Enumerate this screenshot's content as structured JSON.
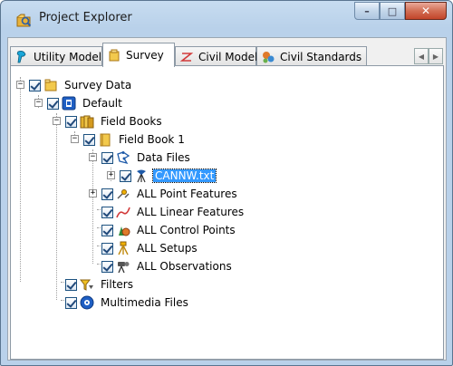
{
  "window": {
    "title": "Project Explorer"
  },
  "caption_buttons": {
    "minimize": "–",
    "maximize": "□",
    "close": "✕"
  },
  "tabs": [
    {
      "label": "Utility Model",
      "icon": "utility-model-icon",
      "active": false
    },
    {
      "label": "Survey",
      "icon": "survey-folder-icon",
      "active": true
    },
    {
      "label": "Civil Model",
      "icon": "civil-model-icon",
      "active": false
    },
    {
      "label": "Civil Standards",
      "icon": "civil-standards-icon",
      "active": false
    }
  ],
  "tab_scroll": {
    "left": "◀",
    "right": "▶"
  },
  "tree": [
    {
      "label": "Survey Data",
      "icon": "folder-icon",
      "expander": "−",
      "checked": true,
      "level": 0
    },
    {
      "label": "Default",
      "icon": "survey-project-icon",
      "expander": "−",
      "checked": true,
      "level": 1
    },
    {
      "label": "Field Books",
      "icon": "field-books-icon",
      "expander": "−",
      "checked": true,
      "level": 2
    },
    {
      "label": "Field Book 1",
      "icon": "folder-icon",
      "expander": "−",
      "checked": true,
      "level": 3
    },
    {
      "label": "Data Files",
      "icon": "data-files-icon",
      "expander": "−",
      "checked": true,
      "level": 4
    },
    {
      "label": "CANNW.txt",
      "icon": "data-file-icon",
      "expander": "+",
      "checked": true,
      "level": 5,
      "selected": true
    },
    {
      "label": "ALL Point Features",
      "icon": "point-features-icon",
      "expander": "+",
      "checked": true,
      "level": 4
    },
    {
      "label": "ALL Linear Features",
      "icon": "linear-features-icon",
      "expander": "",
      "checked": true,
      "level": 4
    },
    {
      "label": "ALL Control Points",
      "icon": "control-points-icon",
      "expander": "",
      "checked": true,
      "level": 4
    },
    {
      "label": "ALL Setups",
      "icon": "setups-icon",
      "expander": "",
      "checked": true,
      "level": 4
    },
    {
      "label": "ALL Observations",
      "icon": "observations-icon",
      "expander": "",
      "checked": true,
      "level": 4
    },
    {
      "label": "Filters",
      "icon": "filters-icon",
      "expander": "",
      "checked": true,
      "level": 2
    },
    {
      "label": "Multimedia Files",
      "icon": "multimedia-icon",
      "expander": "",
      "checked": true,
      "level": 2
    }
  ],
  "colors": {
    "selection": "#3399ff",
    "title_bar": "#b9d1ea",
    "close_button": "#c2452a"
  }
}
